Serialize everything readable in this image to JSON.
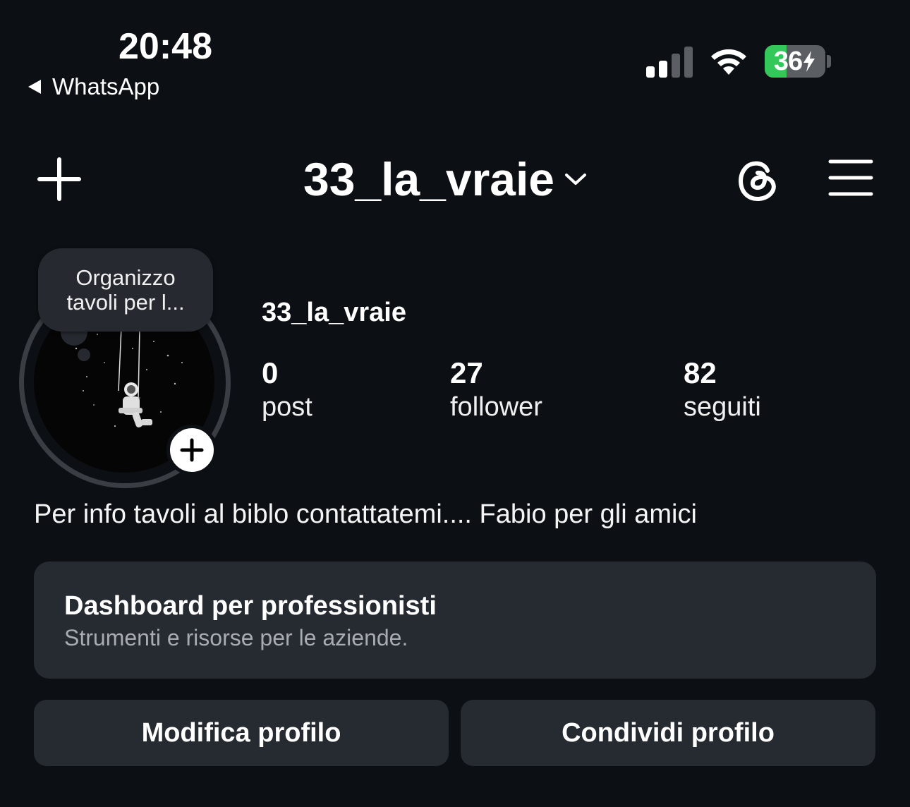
{
  "status_bar": {
    "time": "20:48",
    "back_app": "WhatsApp",
    "battery_level": "36",
    "battery_fraction": 0.36,
    "battery_color": "#34c759"
  },
  "header": {
    "username": "33_la_vraie",
    "left_icon": "plus-icon",
    "right_icons": [
      "threads-icon",
      "menu-icon"
    ]
  },
  "profile": {
    "note": "Organizzo\ntavoli per l...",
    "display_name": "33_la_vraie",
    "stats": [
      {
        "value": "0",
        "label": "post"
      },
      {
        "value": "27",
        "label": "follower"
      },
      {
        "value": "82",
        "label": "seguiti"
      }
    ],
    "bio": "Per info tavoli al biblo contattatemi.... Fabio per gli amici"
  },
  "dashboard": {
    "title": "Dashboard per professionisti",
    "subtitle": "Strumenti e risorse per le aziende."
  },
  "actions": {
    "edit": "Modifica profilo",
    "share": "Condividi profilo"
  }
}
